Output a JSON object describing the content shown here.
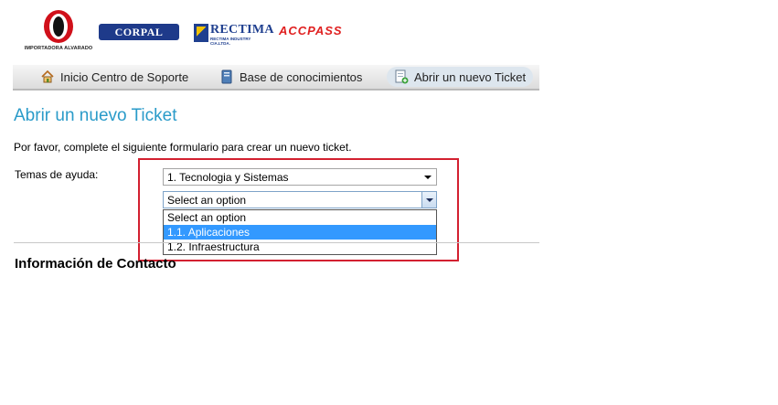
{
  "logos": {
    "alvarado_text": "IMPORTADORA ALVARADO",
    "corpal": "CORPAL",
    "rectima": "RECTIMA",
    "rectima_sub": "RECTIMA INDUSTRY CIA.LTDA.",
    "accpass": "ACCPASS"
  },
  "nav": {
    "items": [
      {
        "label": "Inicio Centro de Soporte",
        "icon": "home-icon"
      },
      {
        "label": "Base de conocimientos",
        "icon": "book-icon"
      },
      {
        "label": "Abrir un nuevo Ticket",
        "icon": "new-ticket-icon"
      }
    ]
  },
  "page": {
    "title": "Abrir un nuevo Ticket",
    "intro": "Por favor, complete el siguiente formulario para crear un nuevo ticket.",
    "temas_label": "Temas de ayuda:",
    "topic_select_value": "1. Tecnologia y Sistemas",
    "subtopic_select_value": "Select an option",
    "subtopic_options": [
      "Select an option",
      "1.1. Aplicaciones",
      "1.2. Infraestructura"
    ],
    "contact_heading": "Información de Contacto"
  },
  "colors": {
    "title": "#2a9bc9",
    "highlight": "#3399ff",
    "annotation_box": "#d32030"
  }
}
